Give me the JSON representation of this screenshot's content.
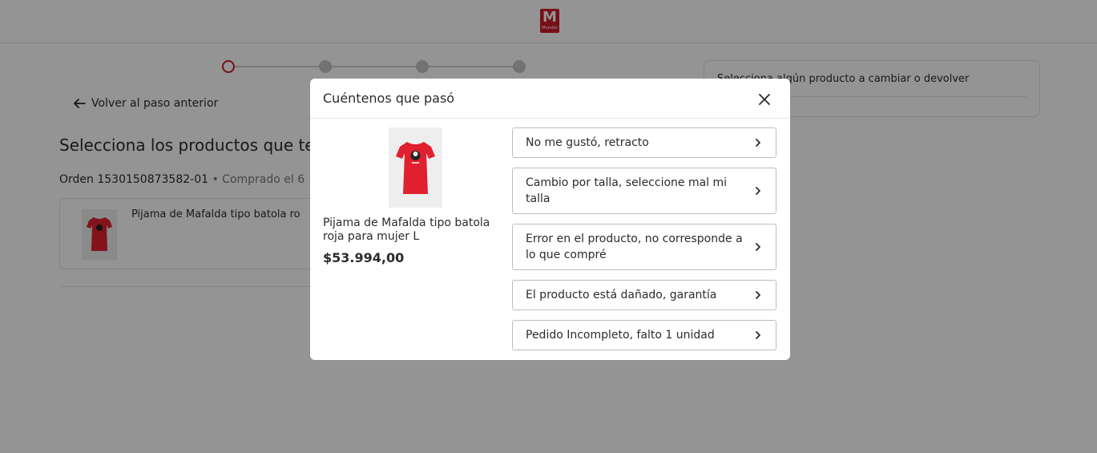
{
  "brand": {
    "logo_letter": "M",
    "logo_sub": "Mundos",
    "color": "#cc1b2b"
  },
  "stepper": {
    "steps": 4,
    "active_index": 0
  },
  "back_link": {
    "label": "Volver al paso anterior"
  },
  "page": {
    "title": "Selecciona los productos que te",
    "order_number": "Orden 1530150873582-01",
    "order_date": " • Comprado el 6",
    "product_name": "Pijama de Mafalda tipo batola ro"
  },
  "summary": {
    "text": "Selecciona algún producto a cambiar o devolver"
  },
  "modal": {
    "title": "Cuéntenos que pasó",
    "product": {
      "name": "Pijama de Mafalda tipo batola roja para mujer L",
      "price": "$53.994,00"
    },
    "reasons": [
      {
        "label": "No me gustó, retracto"
      },
      {
        "label": "Cambio por talla, seleccione mal mi talla"
      },
      {
        "label": "Error en el producto, no corresponde a lo que compré"
      },
      {
        "label": "El producto está dañado, garantía"
      },
      {
        "label": "Pedido Incompleto, falto 1 unidad"
      }
    ]
  },
  "icons": {
    "close": "close-icon",
    "chevron": "chevron-right-icon",
    "back": "arrow-left-icon",
    "shirt_color": "#e0202f"
  }
}
